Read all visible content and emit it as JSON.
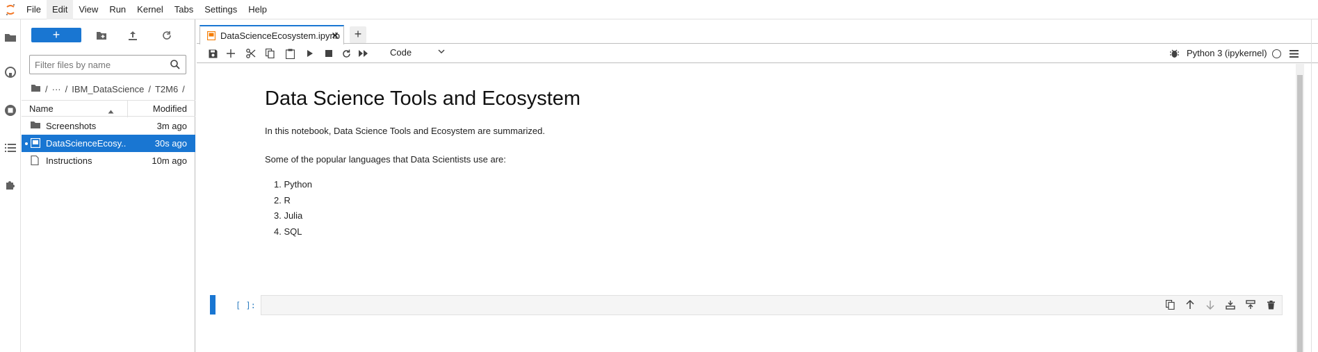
{
  "menubar": {
    "items": [
      "File",
      "Edit",
      "View",
      "Run",
      "Kernel",
      "Tabs",
      "Settings",
      "Help"
    ]
  },
  "activity_bar": {
    "icons": [
      "folder-icon",
      "github-icon",
      "running-icon",
      "toc-icon",
      "extension-icon"
    ]
  },
  "file_browser": {
    "new_label": "+",
    "filter_placeholder": "Filter files by name",
    "breadcrumb": [
      "/",
      "···",
      "/",
      "IBM_DataScience",
      "/",
      "T2M6",
      "/"
    ],
    "columns": {
      "name": "Name",
      "modified": "Modified"
    },
    "rows": [
      {
        "name": "Screenshots",
        "modified": "3m ago",
        "type": "folder"
      },
      {
        "name": "DataScienceEcosy...",
        "modified": "30s ago",
        "type": "notebook",
        "selected": true
      },
      {
        "name": "Instructions",
        "modified": "10m ago",
        "type": "file"
      }
    ]
  },
  "tab": {
    "label": "DataScienceEcosystem.ipynb",
    "close": "✕",
    "add": "+"
  },
  "notebook_toolbar": {
    "cell_type": "Code",
    "kernel": "Python 3 (ipykernel)"
  },
  "notebook": {
    "title": "Data Science Tools and Ecosystem",
    "intro": "In this notebook, Data Science Tools and Ecosystem are summarized.",
    "languages_intro": "Some of the popular languages that Data Scientists use are:",
    "languages": [
      "1. Python",
      "2. R",
      "3. Julia",
      "4. SQL"
    ],
    "code_prompt": "[ ]:"
  },
  "colors": {
    "accent": "#1976d2"
  }
}
